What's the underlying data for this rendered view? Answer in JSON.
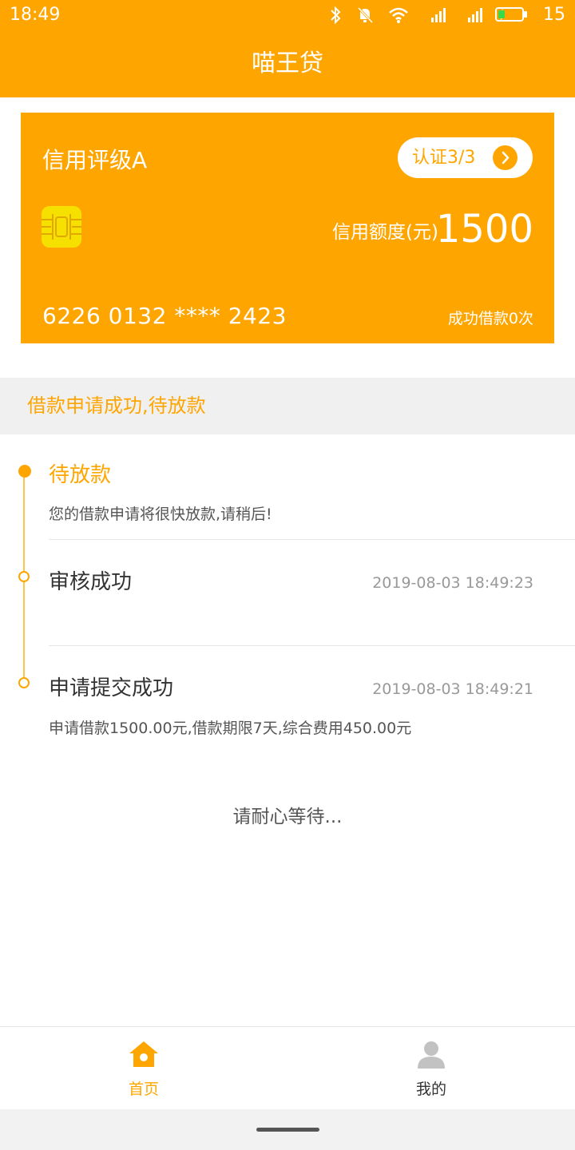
{
  "status_bar": {
    "time": "18:49",
    "battery_level": "15"
  },
  "header": {
    "title": "喵王贷"
  },
  "card": {
    "credit_rating": "信用评级A",
    "certification": "认证3/3",
    "limit_label": "信用额度(元)",
    "limit_value": "1500",
    "card_number": "6226 0132 **** 2423",
    "borrow_count": "成功借款0次"
  },
  "status_banner": "借款申请成功,待放款",
  "timeline": [
    {
      "title": "待放款",
      "time": "",
      "desc": "您的借款申请将很快放款,请稍后!"
    },
    {
      "title": "审核成功",
      "time": "2019-08-03 18:49:23",
      "desc": ""
    },
    {
      "title": "申请提交成功",
      "time": "2019-08-03 18:49:21",
      "desc": "申请借款1500.00元,借款期限7天,综合费用450.00元"
    }
  ],
  "wait_text": "请耐心等待...",
  "bottom_nav": {
    "home_label": "首页",
    "mine_label": "我的"
  },
  "colors": {
    "accent": "#ffa500",
    "chip": "#f5e000"
  }
}
